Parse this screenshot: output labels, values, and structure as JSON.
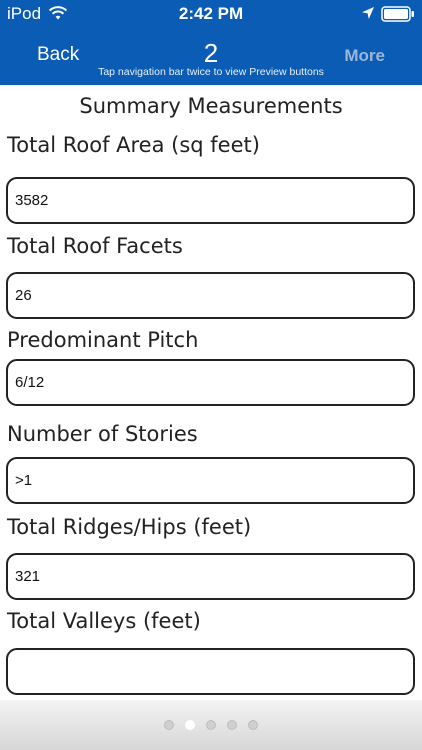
{
  "status_bar": {
    "carrier": "iPod",
    "time": "2:42 PM",
    "icons": [
      "wifi-icon",
      "location-arrow-icon",
      "battery-icon"
    ]
  },
  "nav": {
    "back_label": "Back",
    "title": "2",
    "more_label": "More",
    "hint": "Tap navigation bar twice to view Preview buttons"
  },
  "colors": {
    "nav_background": "#0a5cb4",
    "more_text": "#9bb6d8",
    "field_border": "#222222"
  },
  "content": {
    "section_title": "Summary Measurements",
    "fields": [
      {
        "label": "Total Roof Area (sq feet)",
        "value": "3582"
      },
      {
        "label": "Total Roof Facets",
        "value": "26"
      },
      {
        "label": "Predominant Pitch",
        "value": "6/12"
      },
      {
        "label": "Number of Stories",
        "value": ">1"
      },
      {
        "label": "Total Ridges/Hips (feet)",
        "value": "321"
      },
      {
        "label": "Total Valleys (feet)",
        "value": ""
      }
    ]
  },
  "pager": {
    "page_count": 5,
    "active_index": 1
  }
}
